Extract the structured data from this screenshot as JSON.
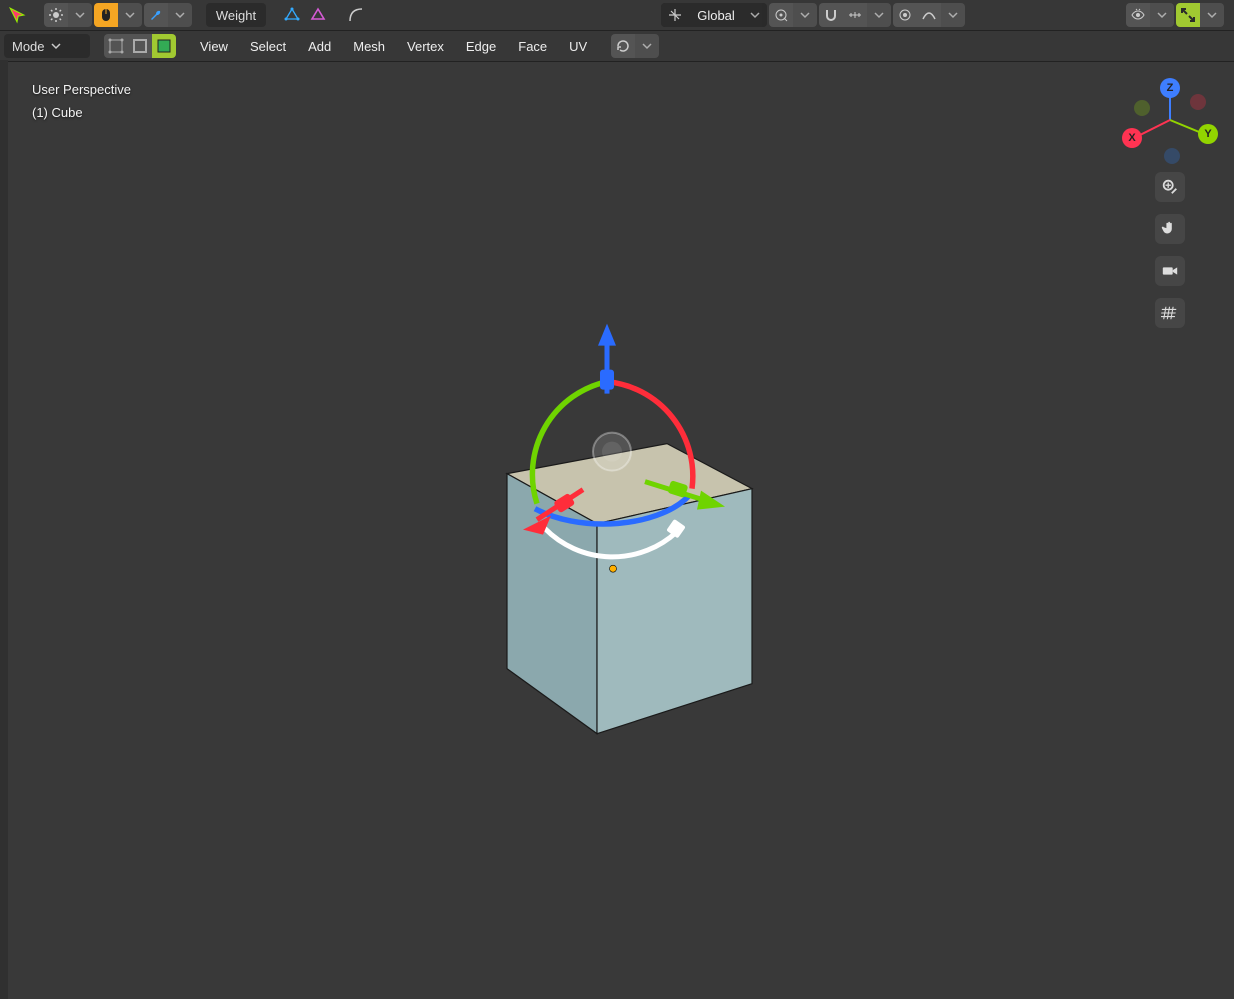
{
  "topbar": {
    "weight_label": "Weight",
    "orientation_label": "Global"
  },
  "header": {
    "mode_label": "Mode",
    "menus": [
      "View",
      "Select",
      "Add",
      "Mesh",
      "Vertex",
      "Edge",
      "Face",
      "UV"
    ]
  },
  "overlay": {
    "line1": "User Perspective",
    "line2": "(1) Cube"
  },
  "gizmo_axes": {
    "x": "X",
    "y": "Y",
    "z": "Z"
  },
  "icons": {
    "cursor": "cursor-icon",
    "options": "options-icon",
    "mouse": "mouse-icon",
    "wrench": "wrench-icon",
    "vertsel": "vertex-select-icon",
    "edgesel": "edge-select-icon",
    "arc": "arc-icon",
    "checker": "checker-icon",
    "orient": "orientation-icon",
    "pivot": "pivot-icon",
    "snap": "snap-icon",
    "snapmode": "snap-mode-icon",
    "propedit": "proportional-edit-icon",
    "falloff": "falloff-icon",
    "selmode_v": "vertex-mode-icon",
    "selmode_e": "edge-mode-icon",
    "selmode_f": "face-mode-icon",
    "history": "history-icon",
    "visibility": "visibility-icon",
    "fullscreen": "fullscreen-icon",
    "zoom": "zoom-icon",
    "pan": "pan-icon",
    "camera": "camera-icon",
    "grid": "grid-icon"
  }
}
